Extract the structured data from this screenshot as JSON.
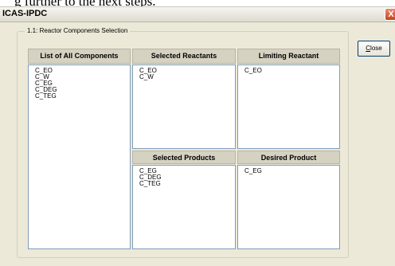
{
  "background_text": "g further to the next steps.",
  "window": {
    "title": "ICAS-IPDC",
    "close_glyph": "X"
  },
  "group": {
    "label": "1.1: Reactor Components Selection"
  },
  "buttons": {
    "close_mnemonic": "C",
    "close_rest": "lose"
  },
  "panels": {
    "all": {
      "header": "List of All Components",
      "items": [
        "C_EO",
        "C_W",
        "C_EG",
        "C_DEG",
        "C_TEG"
      ]
    },
    "reactants": {
      "header": "Selected Reactants",
      "items": [
        "C_EO",
        "C_W"
      ]
    },
    "limiting": {
      "header": "Limiting Reactant",
      "items": [
        "C_EO"
      ]
    },
    "products": {
      "header": "Selected Products",
      "items": [
        "C_EG",
        "C_DEG",
        "C_TEG"
      ]
    },
    "desired": {
      "header": "Desired Product",
      "items": [
        "C_EG"
      ]
    }
  }
}
